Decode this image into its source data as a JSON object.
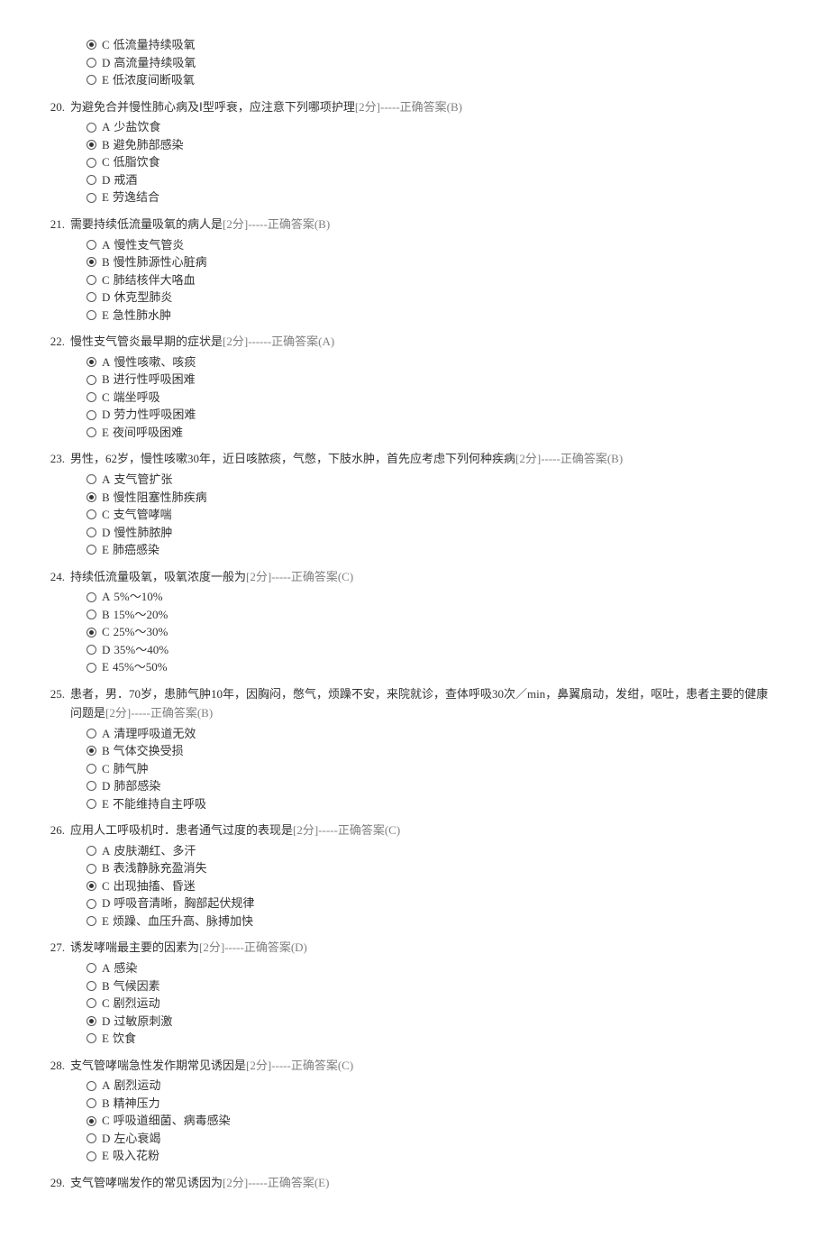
{
  "orphan_options_19": [
    {
      "letter": "C",
      "text": "低流量持续吸氧",
      "selected": true
    },
    {
      "letter": "D",
      "text": "高流量持续吸氧",
      "selected": false
    },
    {
      "letter": "E",
      "text": "低浓度间断吸氧",
      "selected": false
    }
  ],
  "questions": [
    {
      "num": "20.",
      "text": "为避免合并慢性肺心病及Ⅰ型呼衰，应注意下列哪项护理",
      "score": "[2分]",
      "answer": "-----正确答案(B)",
      "options": [
        {
          "letter": "A",
          "text": "少盐饮食",
          "selected": false
        },
        {
          "letter": "B",
          "text": "避免肺部感染",
          "selected": true
        },
        {
          "letter": "C",
          "text": "低脂饮食",
          "selected": false
        },
        {
          "letter": "D",
          "text": "戒酒",
          "selected": false
        },
        {
          "letter": "E",
          "text": "劳逸结合",
          "selected": false
        }
      ]
    },
    {
      "num": "21.",
      "text": "需要持续低流量吸氧的病人是",
      "score": "[2分]",
      "answer": "-----正确答案(B)",
      "options": [
        {
          "letter": "A",
          "text": "慢性支气管炎",
          "selected": false
        },
        {
          "letter": "B",
          "text": "慢性肺源性心脏病",
          "selected": true
        },
        {
          "letter": "C",
          "text": "肺结核伴大咯血",
          "selected": false
        },
        {
          "letter": "D",
          "text": "休克型肺炎",
          "selected": false
        },
        {
          "letter": "E",
          "text": "急性肺水肿",
          "selected": false
        }
      ]
    },
    {
      "num": "22.",
      "text": "慢性支气管炎最早期的症状是",
      "score": "[2分]",
      "answer": "------正确答案(A)",
      "options": [
        {
          "letter": "A",
          "text": "慢性咳嗽、咳痰",
          "selected": true
        },
        {
          "letter": "B",
          "text": "进行性呼吸困难",
          "selected": false
        },
        {
          "letter": "C",
          "text": "端坐呼吸",
          "selected": false
        },
        {
          "letter": "D",
          "text": "劳力性呼吸困难",
          "selected": false
        },
        {
          "letter": "E",
          "text": "夜间呼吸困难",
          "selected": false
        }
      ]
    },
    {
      "num": "23.",
      "text": "男性，62岁，慢性咳嗽30年，近日咳脓痰，气憋，下肢水肿，首先应考虑下列何种疾病",
      "score": "[2分]",
      "answer": "-----正确答案(B)",
      "options": [
        {
          "letter": "A",
          "text": "支气管扩张",
          "selected": false
        },
        {
          "letter": "B",
          "text": "慢性阻塞性肺疾病",
          "selected": true
        },
        {
          "letter": "C",
          "text": "支气管哮喘",
          "selected": false
        },
        {
          "letter": "D",
          "text": "慢性肺脓肿",
          "selected": false
        },
        {
          "letter": "E",
          "text": "肺癌感染",
          "selected": false
        }
      ]
    },
    {
      "num": "24.",
      "text": "持续低流量吸氧，吸氧浓度一般为",
      "score": "[2分]",
      "answer": "-----正确答案(C)",
      "options": [
        {
          "letter": "A",
          "text": "5%～10%",
          "selected": false
        },
        {
          "letter": "B",
          "text": "15%～20%",
          "selected": false
        },
        {
          "letter": "C",
          "text": "25%～30%",
          "selected": true
        },
        {
          "letter": "D",
          "text": "35%～40%",
          "selected": false
        },
        {
          "letter": "E",
          "text": "45%～50%",
          "selected": false
        }
      ]
    },
    {
      "num": "25.",
      "text": "患者，男．70岁，患肺气肿10年，因胸闷，憋气，烦躁不安，来院就诊，查体呼吸30次／min，鼻翼扇动，发绀，呕吐，患者主要的健康问题是",
      "score": "[2分]",
      "answer": "-----正确答案(B)",
      "options": [
        {
          "letter": "A",
          "text": "清理呼吸道无效",
          "selected": false
        },
        {
          "letter": "B",
          "text": "气体交换受损",
          "selected": true
        },
        {
          "letter": "C",
          "text": "肺气肿",
          "selected": false
        },
        {
          "letter": "D",
          "text": "肺部感染",
          "selected": false
        },
        {
          "letter": "E",
          "text": "不能维持自主呼吸",
          "selected": false
        }
      ]
    },
    {
      "num": "26.",
      "text": "应用人工呼吸机时．患者通气过度的表现是",
      "score": "[2分]",
      "answer": "-----正确答案(C)",
      "options": [
        {
          "letter": "A",
          "text": "皮肤潮红、多汗",
          "selected": false
        },
        {
          "letter": "B",
          "text": "表浅静脉充盈消失",
          "selected": false
        },
        {
          "letter": "C",
          "text": "出现抽搐、昏迷",
          "selected": true
        },
        {
          "letter": "D",
          "text": "呼吸音清晰，胸部起伏规律",
          "selected": false
        },
        {
          "letter": "E",
          "text": "烦躁、血压升高、脉搏加快",
          "selected": false
        }
      ]
    },
    {
      "num": "27.",
      "text": "诱发哮喘最主要的因素为",
      "score": "[2分]",
      "answer": "-----正确答案(D)",
      "options": [
        {
          "letter": "A",
          "text": "感染",
          "selected": false
        },
        {
          "letter": "B",
          "text": "气候因素",
          "selected": false
        },
        {
          "letter": "C",
          "text": "剧烈运动",
          "selected": false
        },
        {
          "letter": "D",
          "text": "过敏原刺激",
          "selected": true
        },
        {
          "letter": "E",
          "text": "饮食",
          "selected": false
        }
      ]
    },
    {
      "num": "28.",
      "text": "支气管哮喘急性发作期常见诱因是",
      "score": "[2分]",
      "answer": "-----正确答案(C)",
      "options": [
        {
          "letter": "A",
          "text": "剧烈运动",
          "selected": false
        },
        {
          "letter": "B",
          "text": "精神压力",
          "selected": false
        },
        {
          "letter": "C",
          "text": "呼吸道细菌、病毒感染",
          "selected": true
        },
        {
          "letter": "D",
          "text": "左心衰竭",
          "selected": false
        },
        {
          "letter": "E",
          "text": "吸入花粉",
          "selected": false
        }
      ]
    },
    {
      "num": "29.",
      "text": "支气管哮喘发作的常见诱因为",
      "score": "[2分]",
      "answer": "-----正确答案(E)",
      "options": []
    }
  ]
}
